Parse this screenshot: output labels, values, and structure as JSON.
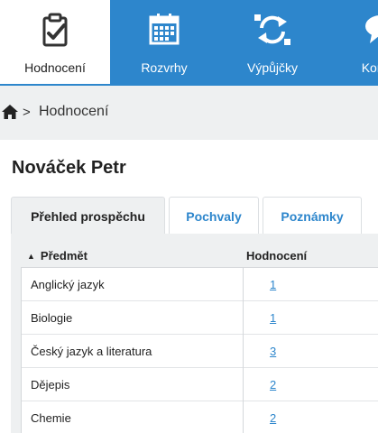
{
  "nav": {
    "items": [
      {
        "label": "Hodnocení",
        "icon": "clipboard-check-icon",
        "active": true
      },
      {
        "label": "Rozvrhy",
        "icon": "calendar-icon",
        "active": false
      },
      {
        "label": "Výpůjčky",
        "icon": "sync-arrows-icon",
        "active": false
      },
      {
        "label": "Komu",
        "icon": "chat-bubble-icon",
        "active": false
      }
    ]
  },
  "breadcrumb": {
    "separator": ">",
    "current": "Hodnocení"
  },
  "page": {
    "title": "Nováček Petr"
  },
  "tabs": [
    {
      "label": "Přehled prospěchu",
      "active": true
    },
    {
      "label": "Pochvaly",
      "active": false
    },
    {
      "label": "Poznámky",
      "active": false
    }
  ],
  "table": {
    "columns": [
      "Předmět",
      "Hodnocení"
    ],
    "sort_indicator": "▲",
    "rows": [
      {
        "subject": "Anglický jazyk",
        "grade": "1"
      },
      {
        "subject": "Biologie",
        "grade": "1"
      },
      {
        "subject": "Český jazyk a literatura",
        "grade": "3"
      },
      {
        "subject": "Dějepis",
        "grade": "2"
      },
      {
        "subject": "Chemie",
        "grade": "2"
      }
    ]
  },
  "colors": {
    "nav_blue": "#2d86cc",
    "panel_gray": "#eef0f1",
    "link_blue": "#2d86cc"
  }
}
